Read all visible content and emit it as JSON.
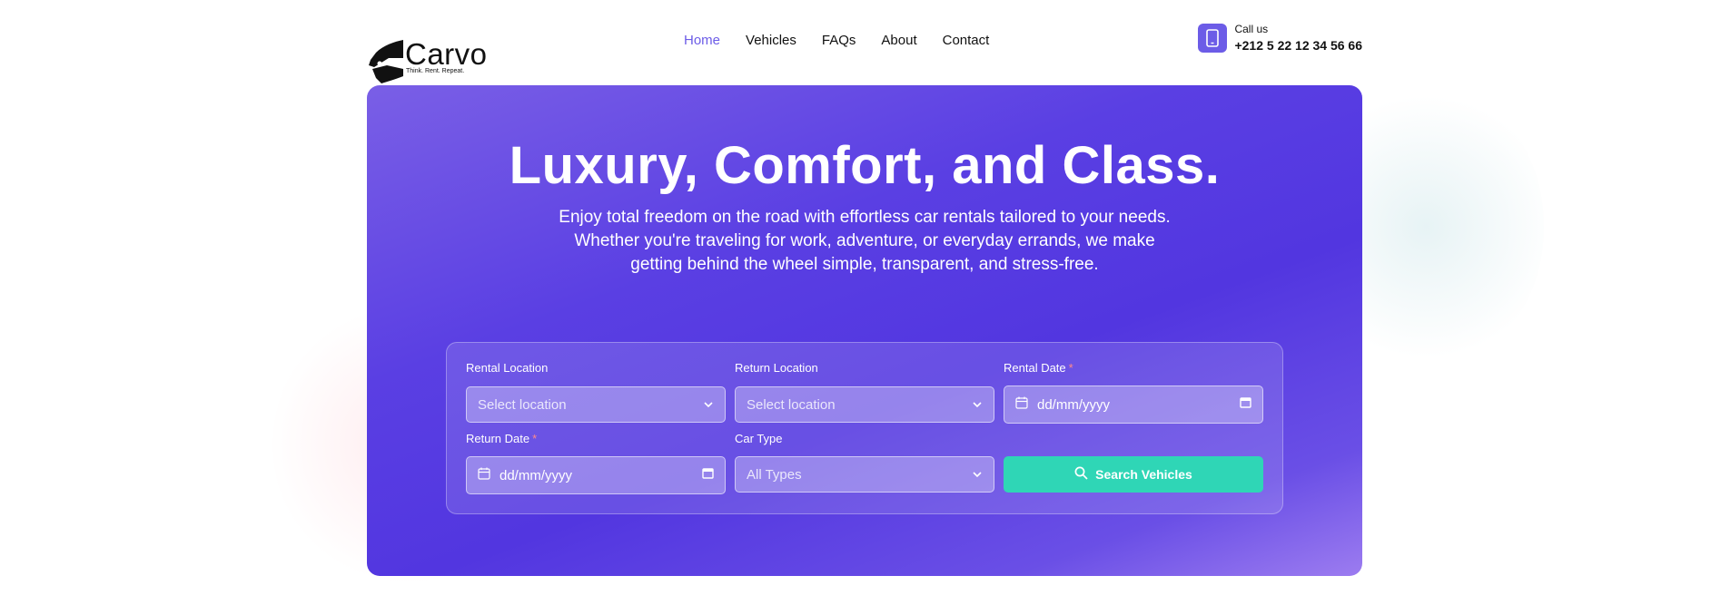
{
  "brand": {
    "name": "Carvo",
    "tagline": "Think. Rent. Repeat."
  },
  "nav": {
    "items": [
      {
        "label": "Home",
        "active": true
      },
      {
        "label": "Vehicles",
        "active": false
      },
      {
        "label": "FAQs",
        "active": false
      },
      {
        "label": "About",
        "active": false
      },
      {
        "label": "Contact",
        "active": false
      }
    ]
  },
  "contact": {
    "label": "Call us",
    "phone": "+212 5 22 12 34 56 66",
    "icon": "smartphone-icon"
  },
  "hero": {
    "title": "Luxury, Comfort, and Class.",
    "subtitle": "Enjoy total freedom on the road with effortless car rentals tailored to your needs. Whether you're traveling for work, adventure, or everyday errands, we make getting behind the wheel simple, transparent, and stress-free."
  },
  "search_form": {
    "rental_location": {
      "label": "Rental Location",
      "placeholder": "Select location"
    },
    "return_location": {
      "label": "Return Location",
      "placeholder": "Select location"
    },
    "rental_date": {
      "label": "Rental Date",
      "required_mark": "*",
      "placeholder": "dd/mm/yyyy"
    },
    "return_date": {
      "label": "Return Date",
      "required_mark": "*",
      "placeholder": "dd/mm/yyyy"
    },
    "car_type": {
      "label": "Car Type",
      "value": "All Types"
    },
    "submit_label": "Search Vehicles"
  },
  "colors": {
    "accent": "#6C5CE7",
    "hero_gradient_start": "#7a5fe6",
    "hero_gradient_end": "#9c7cf0",
    "button": "#2fd6b6"
  }
}
